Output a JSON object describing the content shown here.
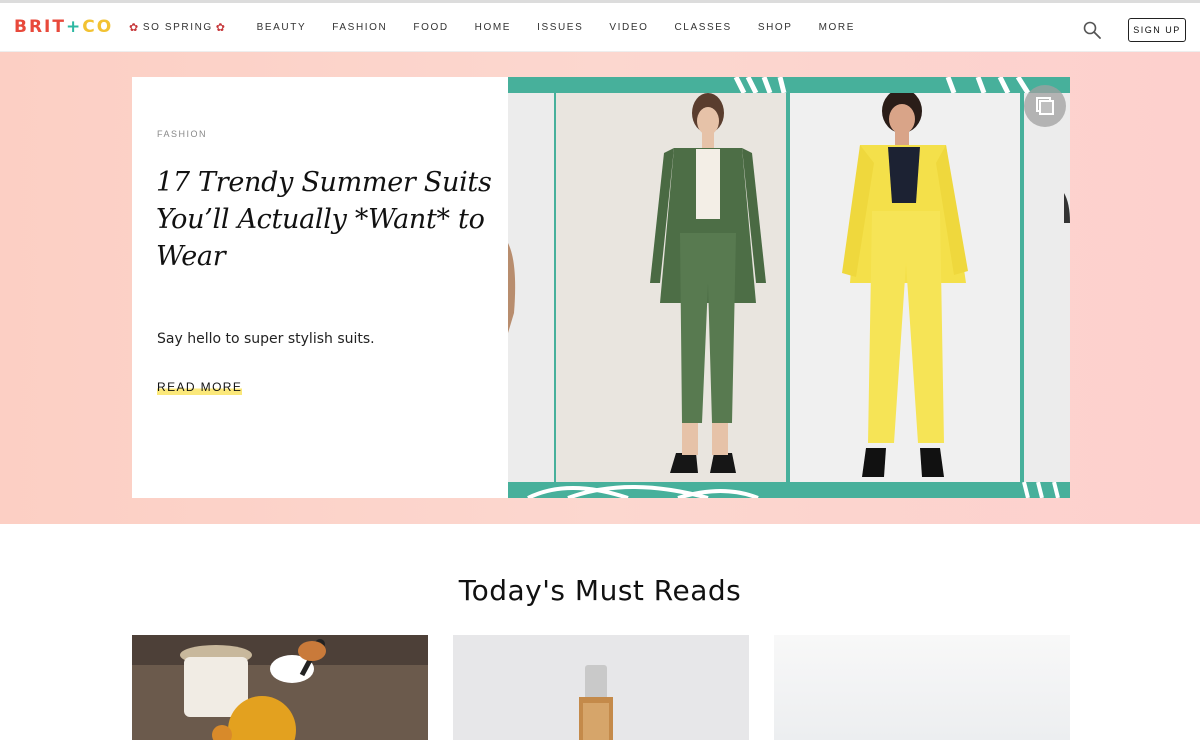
{
  "brand": {
    "part1": "BRIT",
    "plus": "+",
    "part2": "CO"
  },
  "nav": {
    "items": [
      "SO SPRING",
      "BEAUTY",
      "FASHION",
      "FOOD",
      "HOME",
      "ISSUES",
      "VIDEO",
      "CLASSES",
      "SHOP",
      "MORE"
    ],
    "signup_label": "SIGN UP"
  },
  "hero": {
    "category": "FASHION",
    "headline": "17 Trendy Summer Suits You’ll Actually *Want* to Wear",
    "dek": "Say hello to super stylish suits.",
    "read_more": "READ MORE"
  },
  "must_reads": {
    "title": "Today's Must Reads"
  },
  "colors": {
    "accent_teal": "#47b09b",
    "hero_bg": "#fcd3c9",
    "highlight_yellow": "#fbe87a",
    "logo_red": "#e8493b"
  },
  "icons": {
    "search": "search-icon",
    "gallery": "gallery-icon",
    "flower": "flower-icon"
  }
}
